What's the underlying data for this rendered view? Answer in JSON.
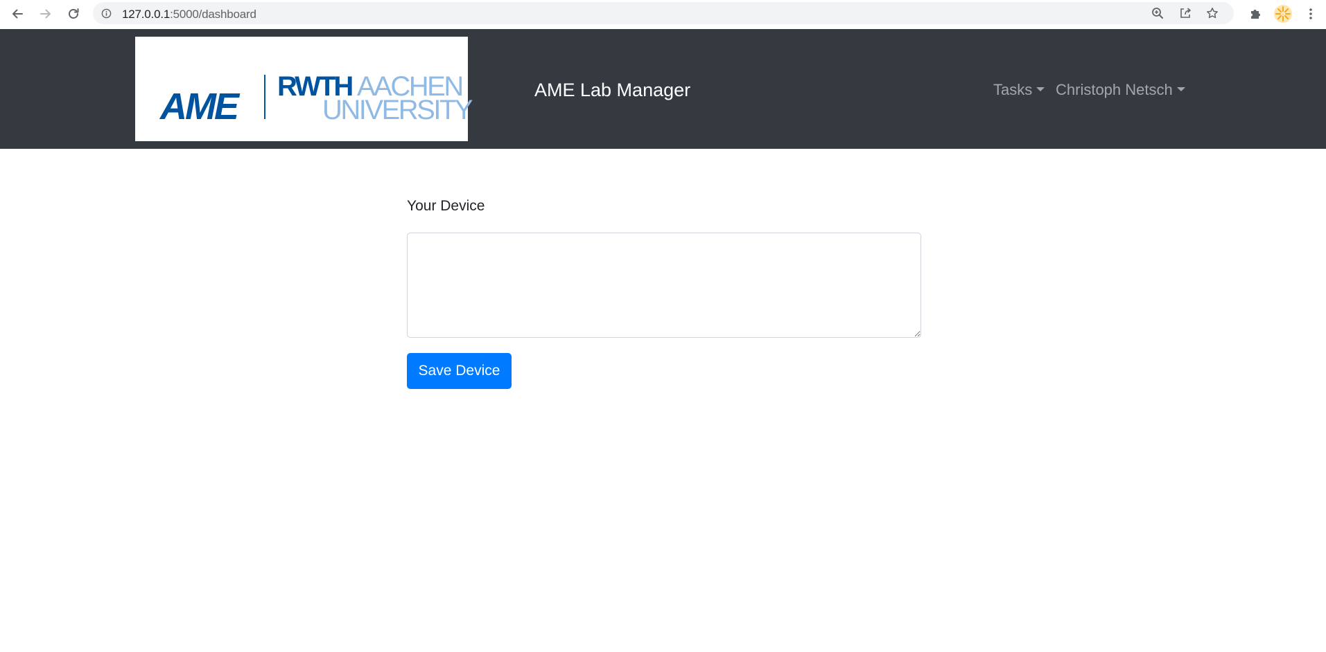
{
  "browser": {
    "url_host": "127.0.0.1",
    "url_path": ":5000/dashboard",
    "icons": {
      "back": "arrow-left-icon",
      "forward": "arrow-right-icon",
      "reload": "reload-icon",
      "info": "info-icon",
      "zoom": "zoom-icon",
      "share": "share-icon",
      "bookmark": "star-icon",
      "extensions": "puzzle-icon",
      "profile": "profile-avatar-icon",
      "menu": "kebab-menu-icon"
    }
  },
  "navbar": {
    "logo": {
      "ame": "AME",
      "rwth": "RWTH",
      "aachen": "AACHEN",
      "university": "UNIVERSITY"
    },
    "title": "AME Lab Manager",
    "menus": [
      {
        "label": "Tasks"
      },
      {
        "label": "Christoph Netsch"
      }
    ],
    "colors": {
      "background": "#343a40",
      "brand_blue": "#00549f",
      "brand_light_blue": "#8ebae5"
    }
  },
  "form": {
    "label": "Your Device",
    "textarea_value": "",
    "save_label": "Save Device",
    "colors": {
      "primary": "#007bff"
    }
  }
}
